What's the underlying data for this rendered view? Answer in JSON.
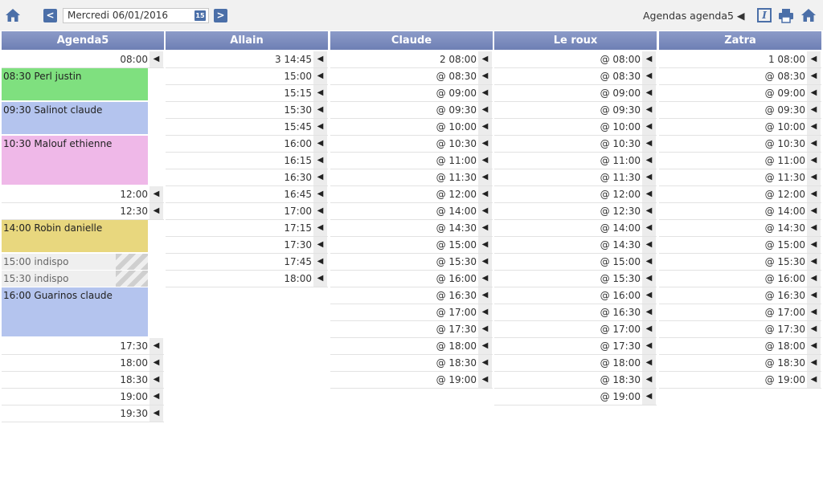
{
  "toolbar": {
    "prev": "<",
    "next": ">",
    "date": "Mercredi 06/01/2016",
    "cal_icon": "15",
    "agendas_label": "Agendas agenda5 ◀",
    "info_icon": "I",
    "icons": [
      "home-icon",
      "calendar-icon",
      "info-icon",
      "print-icon",
      "home-icon"
    ]
  },
  "colors": {
    "header": "#7181b6",
    "green": "#7fe07f",
    "blue": "#b4c4ee",
    "pink": "#efb8e8",
    "yellow": "#e8d77e",
    "indispo": "#efefef"
  },
  "arrow": "◀",
  "columns": [
    {
      "name": "Agenda5",
      "slots": [
        {
          "type": "time",
          "label": "08:00"
        },
        {
          "type": "appt",
          "label": "08:30 Perl justin",
          "color": "green",
          "rows": 2
        },
        {
          "type": "appt",
          "label": "09:30 Salinot claude",
          "color": "blue",
          "rows": 2
        },
        {
          "type": "appt",
          "label": "10:30 Malouf ethienne",
          "color": "pink",
          "rows": 3
        },
        {
          "type": "time",
          "label": "12:00"
        },
        {
          "type": "time",
          "label": "12:30"
        },
        {
          "type": "appt",
          "label": "14:00 Robin danielle",
          "color": "yellow",
          "rows": 2
        },
        {
          "type": "indispo",
          "label": "15:00 indispo"
        },
        {
          "type": "indispo",
          "label": "15:30 indispo"
        },
        {
          "type": "appt",
          "label": "16:00 Guarinos claude",
          "color": "blue",
          "rows": 3
        },
        {
          "type": "time",
          "label": "17:30"
        },
        {
          "type": "time",
          "label": "18:00"
        },
        {
          "type": "time",
          "label": "18:30"
        },
        {
          "type": "time",
          "label": "19:00"
        },
        {
          "type": "time",
          "label": "19:30"
        }
      ]
    },
    {
      "name": "Allain",
      "slots": [
        {
          "type": "time",
          "label": "3 14:45"
        },
        {
          "type": "time",
          "label": "15:00"
        },
        {
          "type": "time",
          "label": "15:15"
        },
        {
          "type": "time",
          "label": "15:30"
        },
        {
          "type": "time",
          "label": "15:45"
        },
        {
          "type": "time",
          "label": "16:00"
        },
        {
          "type": "time",
          "label": "16:15"
        },
        {
          "type": "time",
          "label": "16:30"
        },
        {
          "type": "time",
          "label": "16:45"
        },
        {
          "type": "time",
          "label": "17:00"
        },
        {
          "type": "time",
          "label": "17:15"
        },
        {
          "type": "time",
          "label": "17:30"
        },
        {
          "type": "time",
          "label": "17:45"
        },
        {
          "type": "time",
          "label": "18:00"
        }
      ]
    },
    {
      "name": "Claude",
      "slots": [
        {
          "type": "time",
          "label": "2 08:00"
        },
        {
          "type": "time",
          "label": "@ 08:30"
        },
        {
          "type": "time",
          "label": "@ 09:00"
        },
        {
          "type": "time",
          "label": "@ 09:30"
        },
        {
          "type": "time",
          "label": "@ 10:00"
        },
        {
          "type": "time",
          "label": "@ 10:30"
        },
        {
          "type": "time",
          "label": "@ 11:00"
        },
        {
          "type": "time",
          "label": "@ 11:30"
        },
        {
          "type": "time",
          "label": "@ 12:00"
        },
        {
          "type": "time",
          "label": "@ 14:00"
        },
        {
          "type": "time",
          "label": "@ 14:30"
        },
        {
          "type": "time",
          "label": "@ 15:00"
        },
        {
          "type": "time",
          "label": "@ 15:30"
        },
        {
          "type": "time",
          "label": "@ 16:00"
        },
        {
          "type": "time",
          "label": "@ 16:30"
        },
        {
          "type": "time",
          "label": "@ 17:00"
        },
        {
          "type": "time",
          "label": "@ 17:30"
        },
        {
          "type": "time",
          "label": "@ 18:00"
        },
        {
          "type": "time",
          "label": "@ 18:30"
        },
        {
          "type": "time",
          "label": "@ 19:00"
        }
      ]
    },
    {
      "name": "Le roux",
      "slots": [
        {
          "type": "time",
          "label": "@ 08:00"
        },
        {
          "type": "time",
          "label": "@ 08:30"
        },
        {
          "type": "time",
          "label": "@ 09:00"
        },
        {
          "type": "time",
          "label": "@ 09:30"
        },
        {
          "type": "time",
          "label": "@ 10:00"
        },
        {
          "type": "time",
          "label": "@ 10:30"
        },
        {
          "type": "time",
          "label": "@ 11:00"
        },
        {
          "type": "time",
          "label": "@ 11:30"
        },
        {
          "type": "time",
          "label": "@ 12:00"
        },
        {
          "type": "time",
          "label": "@ 12:30"
        },
        {
          "type": "time",
          "label": "@ 14:00"
        },
        {
          "type": "time",
          "label": "@ 14:30"
        },
        {
          "type": "time",
          "label": "@ 15:00"
        },
        {
          "type": "time",
          "label": "@ 15:30"
        },
        {
          "type": "time",
          "label": "@ 16:00"
        },
        {
          "type": "time",
          "label": "@ 16:30"
        },
        {
          "type": "time",
          "label": "@ 17:00"
        },
        {
          "type": "time",
          "label": "@ 17:30"
        },
        {
          "type": "time",
          "label": "@ 18:00"
        },
        {
          "type": "time",
          "label": "@ 18:30"
        },
        {
          "type": "time",
          "label": "@ 19:00"
        }
      ]
    },
    {
      "name": "Zatra",
      "slots": [
        {
          "type": "time",
          "label": "1 08:00"
        },
        {
          "type": "time",
          "label": "@ 08:30"
        },
        {
          "type": "time",
          "label": "@ 09:00"
        },
        {
          "type": "time",
          "label": "@ 09:30"
        },
        {
          "type": "time",
          "label": "@ 10:00"
        },
        {
          "type": "time",
          "label": "@ 10:30"
        },
        {
          "type": "time",
          "label": "@ 11:00"
        },
        {
          "type": "time",
          "label": "@ 11:30"
        },
        {
          "type": "time",
          "label": "@ 12:00"
        },
        {
          "type": "time",
          "label": "@ 14:00"
        },
        {
          "type": "time",
          "label": "@ 14:30"
        },
        {
          "type": "time",
          "label": "@ 15:00"
        },
        {
          "type": "time",
          "label": "@ 15:30"
        },
        {
          "type": "time",
          "label": "@ 16:00"
        },
        {
          "type": "time",
          "label": "@ 16:30"
        },
        {
          "type": "time",
          "label": "@ 17:00"
        },
        {
          "type": "time",
          "label": "@ 17:30"
        },
        {
          "type": "time",
          "label": "@ 18:00"
        },
        {
          "type": "time",
          "label": "@ 18:30"
        },
        {
          "type": "time",
          "label": "@ 19:00"
        }
      ]
    }
  ]
}
